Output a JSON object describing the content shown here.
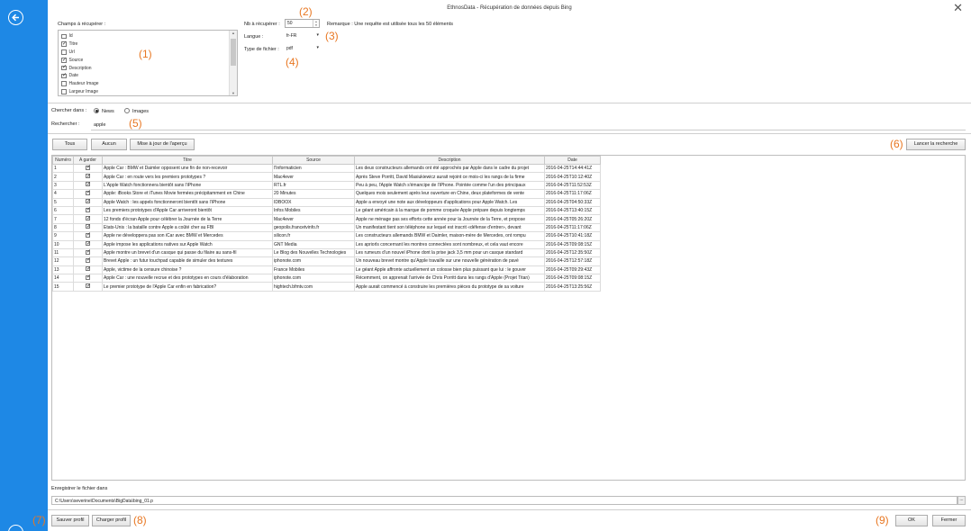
{
  "window": {
    "title": "EthnosData - Récupération de données depuis Bing"
  },
  "markers": [
    "(1)",
    "(2)",
    "(3)",
    "(4)",
    "(5)",
    "(6)",
    "(7)",
    "(8)",
    "(9)"
  ],
  "fields": {
    "label": "Champs à récupérer :",
    "items": [
      {
        "label": "Id",
        "checked": false
      },
      {
        "label": "Titre",
        "checked": true
      },
      {
        "label": "Url",
        "checked": false
      },
      {
        "label": "Source",
        "checked": true
      },
      {
        "label": "Description",
        "checked": true
      },
      {
        "label": "Date",
        "checked": true
      },
      {
        "label": "Hauteur Image",
        "checked": false
      },
      {
        "label": "Largeur Image",
        "checked": false
      }
    ]
  },
  "options": {
    "count_label": "Nb à récupérer :",
    "count_value": "50",
    "note": "Remarque : Une requête est utilisée tous les 50 éléments",
    "language_label": "Langue :",
    "language_value": "fr-FR",
    "filetype_label": "Type de fichier :",
    "filetype_value": "pdf"
  },
  "search": {
    "in_label": "Chercher dans :",
    "radio_news": "News",
    "radio_images": "Images",
    "selected": "News",
    "query_label": "Rechercher :",
    "query_value": "apple"
  },
  "toolbar": {
    "all_label": "Tous",
    "none_label": "Aucun",
    "update_label": "Mise à jour de l'aperçu",
    "launch_label": "Lancer la recherche"
  },
  "table": {
    "columns": [
      "Numéro",
      "A garder",
      "Titre",
      "Source",
      "Description",
      "Date"
    ],
    "rows": [
      {
        "n": "1",
        "keep": true,
        "title": "Apple Car : BMW et Daimler opposent une fin de non-recevoir",
        "source": "l'Informaticien",
        "desc": "Les deux constructeurs allemands ont été approchés par Apple dans le cadre du projet",
        "date": "2016-04-25T14:44:41Z"
      },
      {
        "n": "2",
        "keep": true,
        "title": "Apple Car : en route vers les premiers prototypes ?",
        "source": "Mac4ever",
        "desc": "Après Steve Porritt, David Masiukiewicz aurait rejoint ce mois-ci les rangs de la firme",
        "date": "2016-04-25T10:12:40Z"
      },
      {
        "n": "3",
        "keep": true,
        "title": "L'Apple Watch fonctionnera bientôt sans l'iPhone",
        "source": "RTL.fr",
        "desc": "Peu à peu, l'Apple Watch s'émancipe de l'iPhone. Pointée comme l'un des principaux",
        "date": "2016-04-25T11:52:53Z"
      },
      {
        "n": "4",
        "keep": true,
        "title": "Apple: iBooks Store et iTunes Movie fermées précipitamment en Chine",
        "source": "20 Minutes",
        "desc": "Quelques mois seulement après leur ouverture en Chine, deux plateformes de vente",
        "date": "2016-04-25T11:17:06Z"
      },
      {
        "n": "5",
        "keep": true,
        "title": "Apple Watch : les appels fonctionneront bientôt sans l'iPhone",
        "source": "IDBOOX",
        "desc": "Apple a envoyé une note aux développeurs d'applications pour Apple Watch. Les",
        "date": "2016-04-25T04:50:33Z"
      },
      {
        "n": "6",
        "keep": true,
        "title": "Les premiers prototypes d'Apple Car arriveront bientôt",
        "source": "Infos Mobiles",
        "desc": "Le géant américain à la marque de pomme croquée Apple prépare depuis longtemps",
        "date": "2016-04-25T13:40:15Z"
      },
      {
        "n": "7",
        "keep": true,
        "title": "12 fonds d'écran Apple pour célébrer la Journée de la Terre",
        "source": "Mac4ever",
        "desc": "Apple ne ménage pas ses efforts cette année pour la Journée de la Terre, et propose",
        "date": "2016-04-25T05:26:20Z"
      },
      {
        "n": "8",
        "keep": true,
        "title": "Etats-Unis : la bataille contre Apple a coûté cher au FBI",
        "source": "geopolis.francetvinfo.fr",
        "desc": "Un manifestant tient son téléphone sur lequel est inscrit «défense d'entrer», devant",
        "date": "2016-04-25T11:17:06Z"
      },
      {
        "n": "9",
        "keep": true,
        "title": "Apple ne développera pas son iCar avec BMW et Mercedes",
        "source": "silicon.fr",
        "desc": "Les constructeurs allemands BMW et Daimler, maison-mère de Mercedes, ont rompu",
        "date": "2016-04-25T10:41:18Z"
      },
      {
        "n": "10",
        "keep": true,
        "title": "Apple impose les applications natives sur Apple Watch",
        "source": "GNT Media",
        "desc": "Les apriorls concernant les montres connectées sont nombreux, et cela vaut encore",
        "date": "2016-04-25T09:08:15Z"
      },
      {
        "n": "11",
        "keep": true,
        "title": "Apple montre un brevet d'un casque qui passe du filaire au sans-fil",
        "source": "Le Blog des Nouvelles Technologies",
        "desc": "Les rumeurs d'un nouvel iPhone dont la prise jack 3,5 mm pour un casque standard",
        "date": "2016-04-25T12:35:50Z"
      },
      {
        "n": "12",
        "keep": true,
        "title": "Brevet Apple : un futur touchpad capable de simuler des textures",
        "source": "iphonote.com",
        "desc": "Un nouveau brevet montre qu'Apple travaille sur une nouvelle génération de pavé",
        "date": "2016-04-25T12:57:18Z"
      },
      {
        "n": "13",
        "keep": true,
        "title": "Apple, victime de la censure chinoise ?",
        "source": "France Mobiles",
        "desc": "Le géant Apple affronte actuellement un colosse bien plus puissant que lui : le gouver",
        "date": "2016-04-25T09:29:43Z"
      },
      {
        "n": "14",
        "keep": true,
        "title": "Apple Car : une nouvelle recrue et des prototypes en cours d'élaboration",
        "source": "iphonote.com",
        "desc": "Récemment, on apprenait l'arrivée de Chris Porritt dans les rangs d'Apple (Projet Titan)",
        "date": "2016-04-25T09:08:15Z"
      },
      {
        "n": "15",
        "keep": true,
        "title": "Le premier prototype de l'Apple Car enfin en fabrication?",
        "source": "hightech.bfmtv.com",
        "desc": "Apple aurait commencé à construire les premières pièces du prototype de sa voiture",
        "date": "2016-04-25T13:25:56Z"
      }
    ]
  },
  "save": {
    "label": "Enregistrer le fichier dans",
    "path": "C:\\Users\\severine\\Documents\\BigData\\bing_01.p",
    "browse_label": "..."
  },
  "footer": {
    "save_profile": "Sauver profil",
    "load_profile": "Charger profil",
    "ok": "OK",
    "close": "Fermer"
  }
}
